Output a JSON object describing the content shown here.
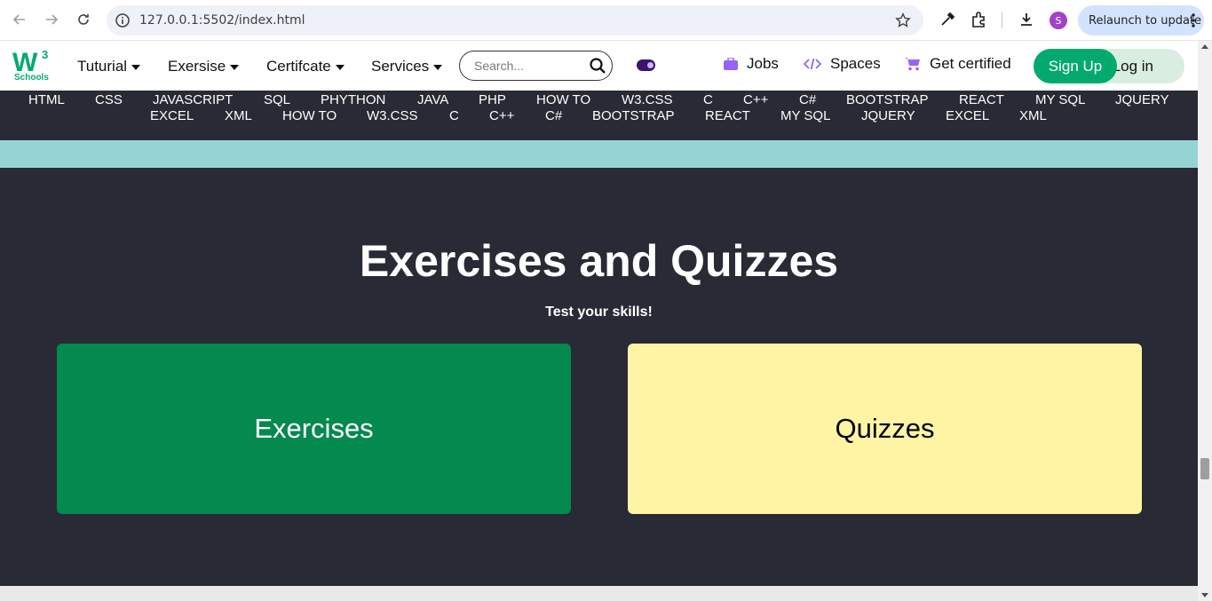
{
  "browser": {
    "url": "127.0.0.1:5502/index.html",
    "profile_initial": "S",
    "relaunch_label": "Relaunch to update"
  },
  "site": {
    "logo": {
      "mark": "W",
      "superscript": "3",
      "caption": "Schools"
    },
    "menu": [
      "Tuturial",
      "Exersise",
      "Certifcate",
      "Services"
    ],
    "search_placeholder": "Search...",
    "links": {
      "jobs": "Jobs",
      "spaces": "Spaces",
      "certified": "Get certified"
    },
    "signup": "Sign Up",
    "login": "Log in"
  },
  "subnav": {
    "row1": [
      "HTML",
      "CSS",
      "JAVASCRIPT",
      "SQL",
      "PHYTHON",
      "JAVA",
      "PHP",
      "HOW TO",
      "W3.CSS",
      "C",
      "C++",
      "C#",
      "BOOTSTRAP",
      "REACT",
      "MY SQL",
      "JQUERY"
    ],
    "row2": [
      "EXCEL",
      "XML",
      "HOW TO",
      "W3.CSS",
      "C",
      "C++",
      "C#",
      "BOOTSTRAP",
      "REACT",
      "MY SQL",
      "JQUERY",
      "EXCEL",
      "XML"
    ]
  },
  "section": {
    "title": "Exercises and Quizzes",
    "subtitle": "Test your skills!",
    "cards": {
      "exercises": "Exercises",
      "quizzes": "Quizzes"
    }
  },
  "colors": {
    "brand_green": "#04aa6d",
    "dark": "#282a35",
    "teal": "#96d4d4",
    "exercises_card": "#04894f",
    "quizzes_card": "#fff4a3"
  }
}
